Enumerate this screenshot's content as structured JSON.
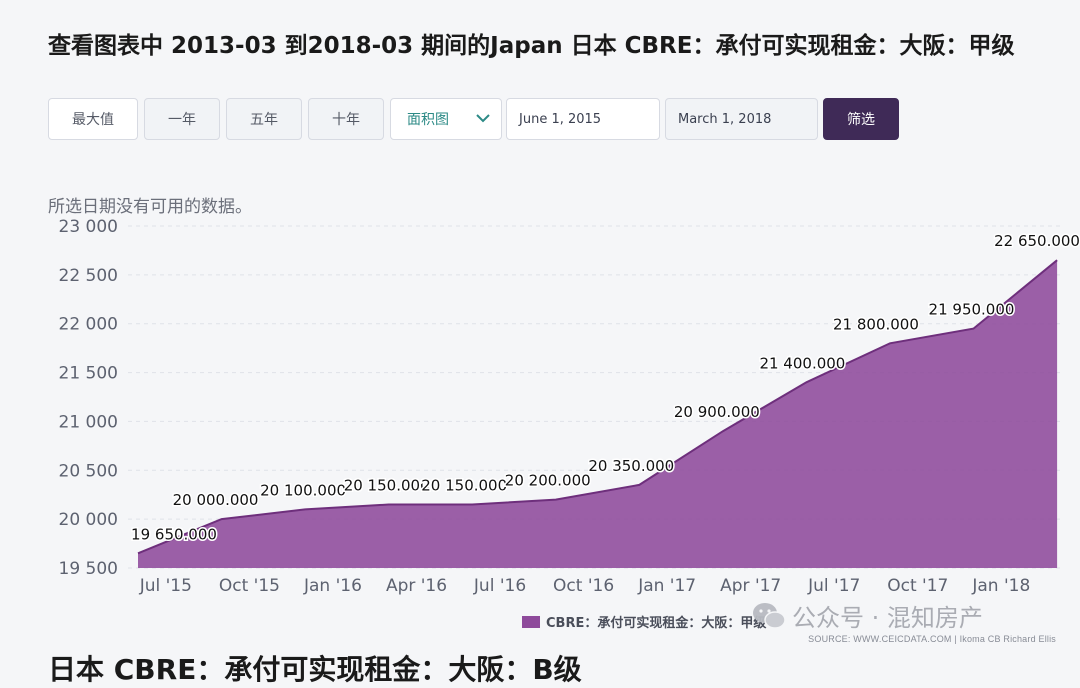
{
  "page": {
    "title": "查看图表中 2013-03 到2018-03 期间的Japan 日本 CBRE：承付可实现租金：大阪：甲级",
    "next_title": "日本 CBRE：承付可实现租金：大阪：B级"
  },
  "toolbar": {
    "buttons": [
      "最大值",
      "一年",
      "五年",
      "十年"
    ],
    "chart_type": "面积图",
    "start_date": "June 1, 2015",
    "end_date": "March 1, 2018",
    "filter_label": "筛选"
  },
  "notice": "所选日期没有可用的数据。",
  "legend": {
    "label": "CBRE：承付可实现租金：大阪：甲级",
    "color": "#8e4a9b"
  },
  "source": "SOURCE: WWW.CEICDATA.COM | Ikoma CB Richard Ellis",
  "watermark": "公众号 · 混知房产",
  "colors": {
    "area": "#8e4a9b",
    "line": "#6e2f7c",
    "filter_button": "#3f2a57",
    "select_text": "#2c8a86"
  },
  "chart_data": {
    "type": "area",
    "x": [
      "2015-06",
      "2015-09",
      "2015-12",
      "2016-03",
      "2016-06",
      "2016-09",
      "2016-12",
      "2017-03",
      "2017-06",
      "2017-09",
      "2017-12",
      "2018-03"
    ],
    "tick_labels": [
      "Jul '15",
      "Oct '15",
      "Jan '16",
      "Apr '16",
      "Jul '16",
      "Oct '16",
      "Jan '17",
      "Apr '17",
      "Jul '17",
      "Oct '17",
      "Jan '18"
    ],
    "y_ticks": [
      "23 000",
      "22 500",
      "22 000",
      "21 500",
      "21 000",
      "20 500",
      "20 000",
      "19 500"
    ],
    "series": [
      {
        "values": [
          19650,
          20000,
          20100,
          20150,
          20150,
          20200,
          20350,
          20900,
          21400,
          21800,
          21950,
          22650
        ],
        "labels": [
          "19 650.000",
          "20 000.000",
          "20 100.000",
          "20 150.000",
          "20 150.000",
          "20 200.000",
          "20 350.000",
          "20 900.000",
          "21 400.000",
          "21 800.000",
          "21 950.000",
          "22 650.000"
        ]
      }
    ],
    "ylim": [
      19500,
      23000
    ],
    "grid": true,
    "legend_position": "bottom-right"
  }
}
